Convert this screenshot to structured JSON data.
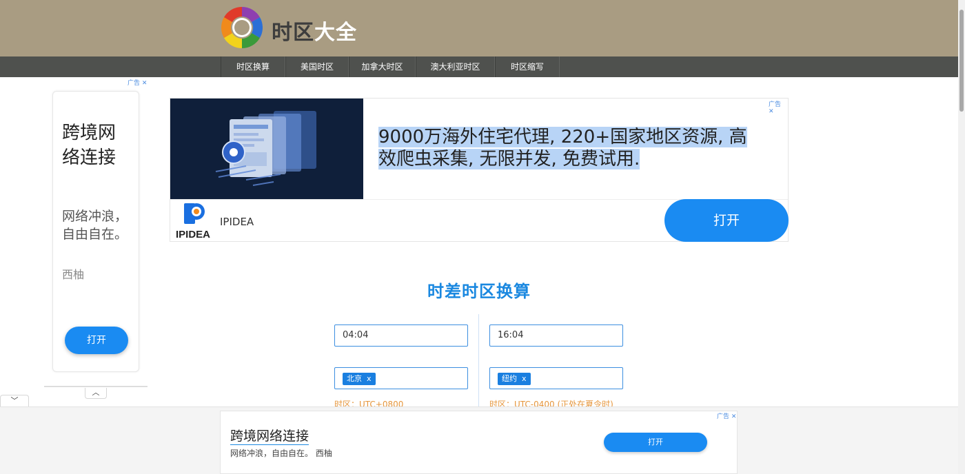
{
  "site": {
    "logo_icon": "color-wheel-icon",
    "logo_part1": "时区",
    "logo_part2": "大全"
  },
  "nav": {
    "items": [
      {
        "label": "时区换算"
      },
      {
        "label": "美国时区"
      },
      {
        "label": "加拿大时区"
      },
      {
        "label": "澳大利亚时区"
      },
      {
        "label": "时区缩写"
      }
    ]
  },
  "side_ad": {
    "tag": "广告",
    "headline": "跨境网络连接",
    "description": "网络冲浪，自由自在。",
    "brand": "西柚",
    "button": "打开"
  },
  "main_ad": {
    "tag": "广告",
    "headline": "9000万海外住宅代理, 220+国家地区资源, 高效爬虫采集, 无限并发, 免费试用.",
    "logo_word": "IPIDEA",
    "brand": "IPIDEA",
    "button": "打开"
  },
  "converter": {
    "title": "时差时区换算",
    "left": {
      "time": "04:04",
      "zone": "北京",
      "offset": "时区：UTC+0800"
    },
    "right": {
      "time": "16:04",
      "zone": "纽约",
      "offset": "时区：UTC-0400 (正处在夏令时)"
    },
    "remove_glyph": "x"
  },
  "bottom_ad": {
    "tag": "广告",
    "headline": "跨境网络连接",
    "description": "网络冲浪，自由自在。 西柚",
    "button": "打开"
  },
  "colors": {
    "header_bg": "#a99c82",
    "nav_bg": "#4f514e",
    "accent": "#1a88e0",
    "offset_text": "#e6963c"
  }
}
